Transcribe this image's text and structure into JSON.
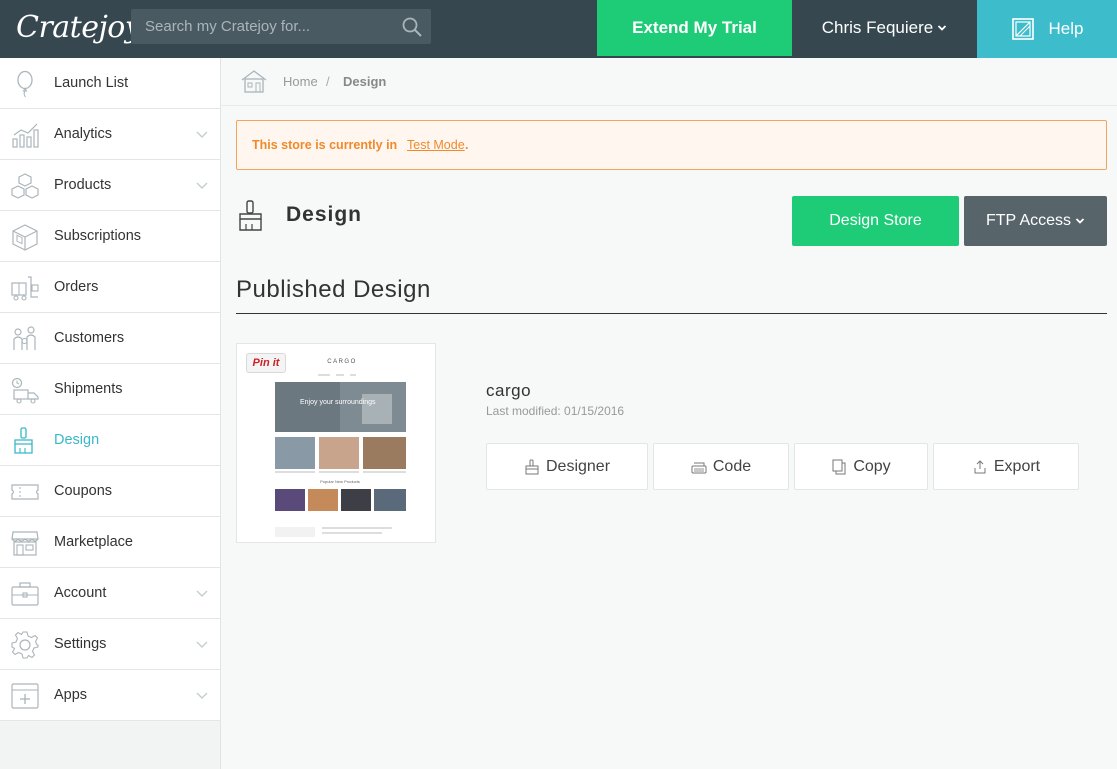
{
  "header": {
    "logo": "Cratejoy",
    "search_placeholder": "Search my Cratejoy for...",
    "trial_label": "Extend My Trial",
    "user_label": "Chris Fequiere",
    "help_label": "Help"
  },
  "sidebar": {
    "items": [
      {
        "label": "Launch List",
        "icon": "balloon-icon",
        "has_chevron": false
      },
      {
        "label": "Analytics",
        "icon": "chart-icon",
        "has_chevron": true
      },
      {
        "label": "Products",
        "icon": "boxes-icon",
        "has_chevron": true
      },
      {
        "label": "Subscriptions",
        "icon": "crate-icon",
        "has_chevron": false
      },
      {
        "label": "Orders",
        "icon": "cart-icon",
        "has_chevron": false
      },
      {
        "label": "Customers",
        "icon": "people-icon",
        "has_chevron": false
      },
      {
        "label": "Shipments",
        "icon": "truck-icon",
        "has_chevron": false
      },
      {
        "label": "Design",
        "icon": "brush-icon",
        "has_chevron": false,
        "active": true
      },
      {
        "label": "Coupons",
        "icon": "ticket-icon",
        "has_chevron": false
      },
      {
        "label": "Marketplace",
        "icon": "store-icon",
        "has_chevron": false
      },
      {
        "label": "Account",
        "icon": "briefcase-icon",
        "has_chevron": true
      },
      {
        "label": "Settings",
        "icon": "gear-icon",
        "has_chevron": true
      },
      {
        "label": "Apps",
        "icon": "app-plus-icon",
        "has_chevron": true
      }
    ]
  },
  "breadcrumb": {
    "home": "Home",
    "separator": "/",
    "current": "Design"
  },
  "alert": {
    "text": "This store is currently in",
    "link": "Test Mode",
    "suffix": "."
  },
  "page": {
    "title": "Design",
    "design_store_label": "Design Store",
    "ftp_label": "FTP Access"
  },
  "published": {
    "section_title": "Published Design",
    "pin_label": "Pin it",
    "thumb_brand": "CARGO",
    "thumb_hero": "Enjoy your surroundings",
    "thumb_popular": "Popular New Products",
    "theme_name": "cargo",
    "last_modified": "Last modified: 01/15/2016",
    "actions": {
      "designer": "Designer",
      "code": "Code",
      "copy": "Copy",
      "export": "Export"
    }
  },
  "colors": {
    "topbar": "#36474f",
    "accent_green": "#1ecc78",
    "accent_teal": "#3dbdcc",
    "alert_orange": "#ef8a2b"
  }
}
